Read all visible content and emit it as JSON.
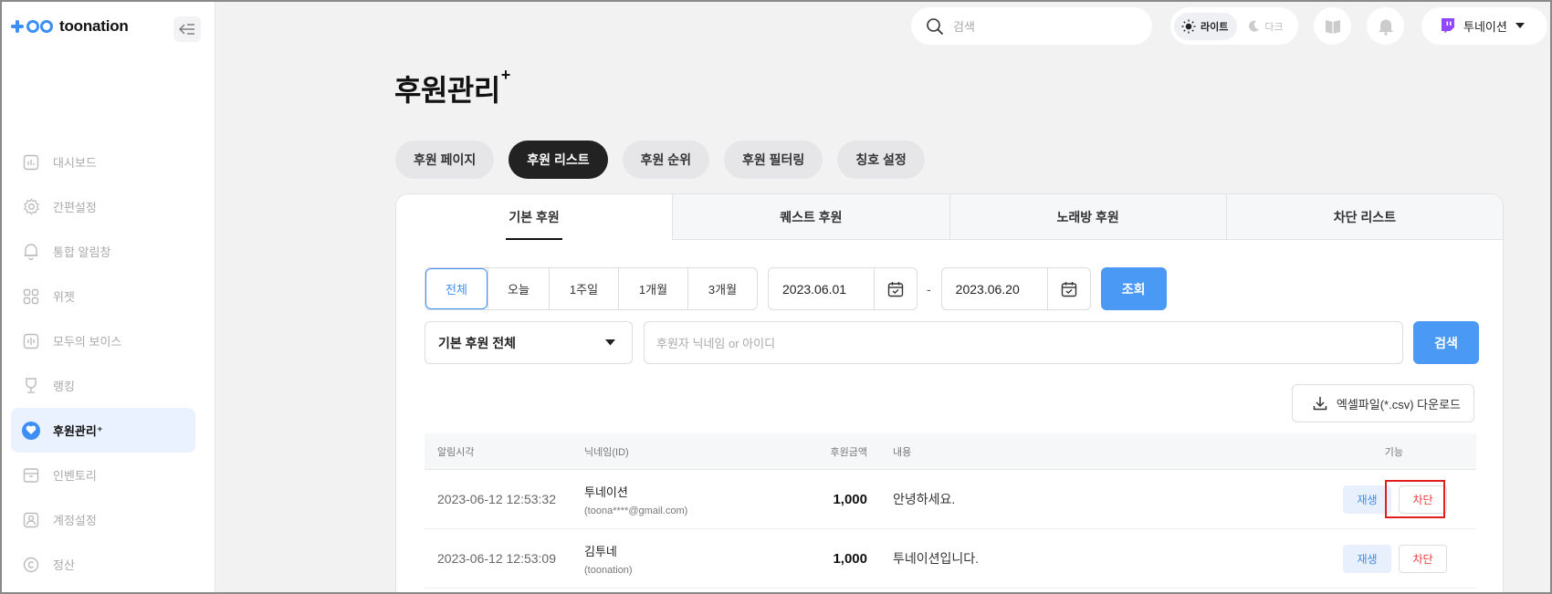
{
  "brand": {
    "name": "toonation"
  },
  "sidebar": {
    "items": [
      {
        "label": "대시보드",
        "icon": "chart-icon"
      },
      {
        "label": "간편설정",
        "icon": "gear-icon"
      },
      {
        "label": "통합 알림창",
        "icon": "bell-icon"
      },
      {
        "label": "위젯",
        "icon": "grid-icon"
      },
      {
        "label": "모두의 보이스",
        "icon": "voice-icon"
      },
      {
        "label": "랭킹",
        "icon": "trophy-icon"
      },
      {
        "label": "후원관리⁺",
        "icon": "heart-icon",
        "active": true
      },
      {
        "label": "인벤토리",
        "icon": "inventory-icon"
      },
      {
        "label": "계정설정",
        "icon": "user-icon"
      },
      {
        "label": "정산",
        "icon": "copyright-icon"
      }
    ]
  },
  "topbar": {
    "search_placeholder": "검색",
    "theme_light": "라이트",
    "theme_dark": "다크",
    "user_name": "투네이션"
  },
  "page": {
    "title": "후원관리",
    "title_sup": "+",
    "tabs": [
      "후원 페이지",
      "후원 리스트",
      "후원 순위",
      "후원 필터링",
      "칭호 설정"
    ],
    "active_tab": "후원 리스트",
    "subtabs": [
      "기본 후원",
      "퀘스트 후원",
      "노래방 후원",
      "차단 리스트"
    ],
    "active_subtab": "기본 후원"
  },
  "filters": {
    "periods": [
      "전체",
      "오늘",
      "1주일",
      "1개월",
      "3개월"
    ],
    "active_period": "전체",
    "date_from": "2023.06.01",
    "date_sep": "-",
    "date_to": "2023.06.20",
    "query_button": "조회",
    "type_select": "기본 후원 전체",
    "search_placeholder": "후원자 닉네임 or 아이디",
    "search_button": "검색",
    "excel_button": "엑셀파일(*.csv) 다운로드"
  },
  "table": {
    "headers": {
      "time": "알림시각",
      "nick": "닉네임(ID)",
      "amount": "후원금액",
      "message": "내용",
      "function": "기능"
    },
    "rows": [
      {
        "time": "2023-06-12 12:53:32",
        "nick": "투네이션",
        "id": "(toona****@gmail.com)",
        "amount": "1,000",
        "message": "안녕하세요.",
        "play": "재생",
        "block": "차단"
      },
      {
        "time": "2023-06-12 12:53:09",
        "nick": "김투네",
        "id": "(toonation)",
        "amount": "1,000",
        "message": "투네이션입니다.",
        "play": "재생",
        "block": "차단"
      }
    ]
  },
  "colors": {
    "accent": "#3d8ff5",
    "danger": "#ef3b3b",
    "highlight": "#e31c1c"
  }
}
